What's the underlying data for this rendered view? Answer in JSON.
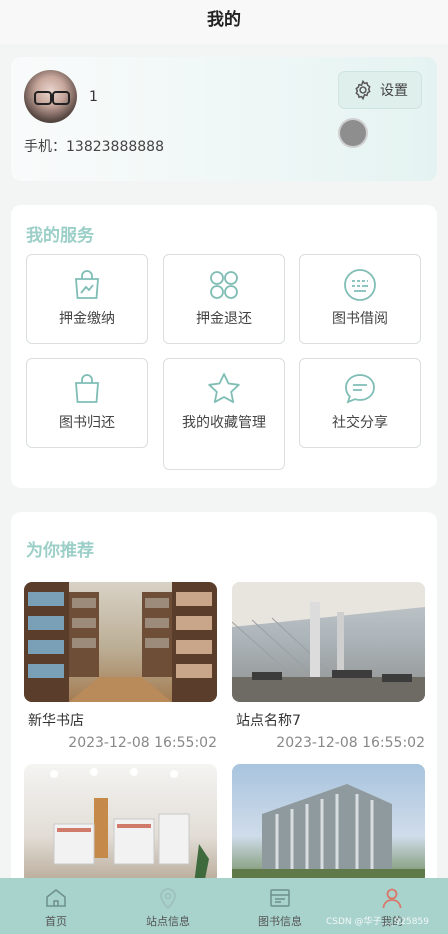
{
  "header": {
    "title": "我的"
  },
  "profile": {
    "username": "1",
    "phone": "手机：13823888888",
    "settings_label": "设置"
  },
  "services": {
    "title": "我的服务",
    "items": [
      {
        "label": "押金缴纳",
        "icon": "bag-chart-icon"
      },
      {
        "label": "押金退还",
        "icon": "four-circles-icon"
      },
      {
        "label": "图书借阅",
        "icon": "keyboard-circle-icon"
      },
      {
        "label": "图书归还",
        "icon": "shopping-bag-icon"
      },
      {
        "label": "我的收藏管理",
        "icon": "star-icon"
      },
      {
        "label": "社交分享",
        "icon": "chat-bubble-icon"
      }
    ]
  },
  "recommend": {
    "title": "为你推荐",
    "items": [
      {
        "name": "新华书店",
        "time": "2023-12-08 16:55:02"
      },
      {
        "name": "站点名称7",
        "time": "2023-12-08 16:55:02"
      },
      {
        "name": "",
        "time": ""
      },
      {
        "name": "",
        "time": ""
      }
    ]
  },
  "tabbar": {
    "items": [
      {
        "label": "首页",
        "icon": "home-icon"
      },
      {
        "label": "站点信息",
        "icon": "location-icon"
      },
      {
        "label": "图书信息",
        "icon": "book-icon"
      },
      {
        "label": "我的",
        "icon": "user-icon"
      }
    ]
  },
  "watermark": "CSDN @华子..._925859",
  "colors": {
    "accent": "#9ccfc8",
    "tabbar": "#a8d2cc",
    "active": "#d9776c"
  }
}
